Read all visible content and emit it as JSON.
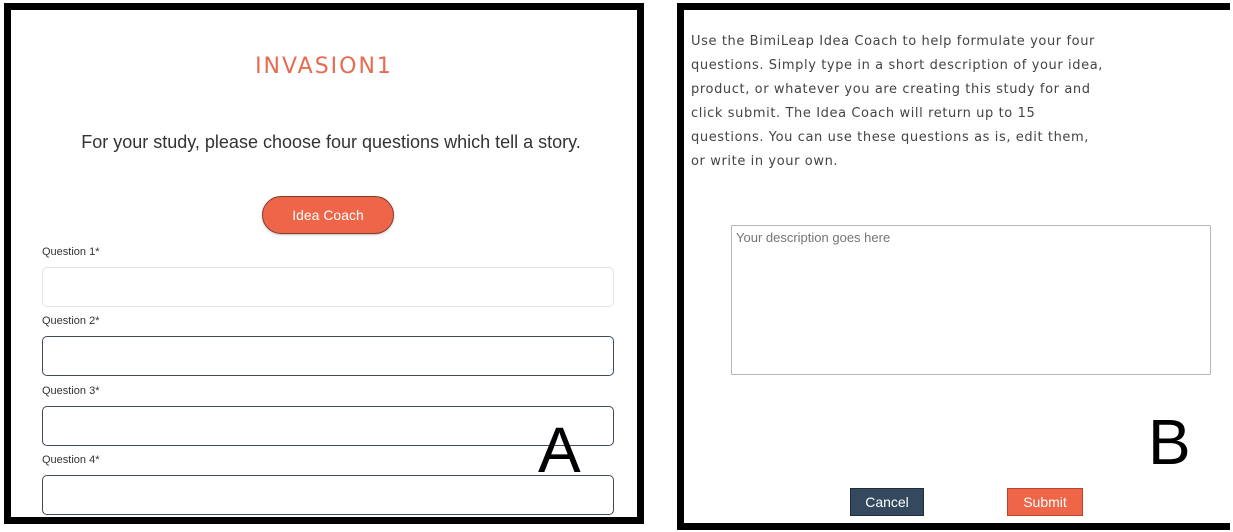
{
  "panel_a": {
    "title": "INVASION1",
    "subtitle": "For your study, please choose four questions which tell a story.",
    "idea_coach_label": "Idea Coach",
    "questions": [
      {
        "label": "Question 1*",
        "value": ""
      },
      {
        "label": "Question 2*",
        "value": ""
      },
      {
        "label": "Question 3*",
        "value": ""
      },
      {
        "label": "Question 4*",
        "value": ""
      }
    ],
    "marker": "A"
  },
  "panel_b": {
    "instructions": "Use the BimiLeap Idea Coach to help formulate your four\nquestions. Simply type in a short description of your idea,\nproduct, or whatever you are creating this study for and\nclick submit. The Idea Coach will return up to 15\nquestions. You can use these questions as is, edit them,\nor write in your own.",
    "description_placeholder": "Your description goes here",
    "cancel_label": "Cancel",
    "submit_label": "Submit",
    "marker": "B"
  },
  "colors": {
    "accent": "#ef6548",
    "title": "#e86a4f",
    "cancel": "#34495e",
    "border": "#000000"
  }
}
